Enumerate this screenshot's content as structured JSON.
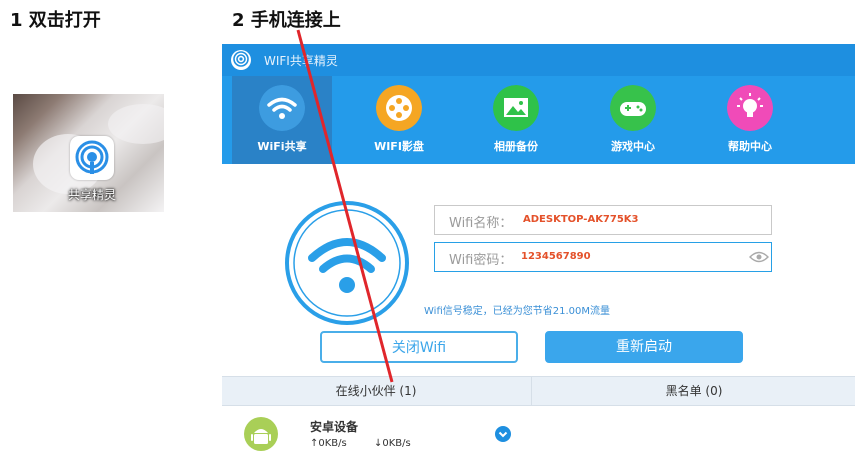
{
  "steps": {
    "step1": "1 双击打开",
    "step2": "2 手机连接上"
  },
  "desktop": {
    "shortcut_label": "共享精灵",
    "shortcut_icon": "wifi-genie-app-icon"
  },
  "app": {
    "title": "WIFI共享精灵",
    "nav": [
      {
        "label": "WiFi共享",
        "icon": "wifi-icon",
        "color": "#2a82c7"
      },
      {
        "label": "WIFI影盘",
        "icon": "film-reel-icon",
        "color": "#f5a623"
      },
      {
        "label": "相册备份",
        "icon": "photo-icon",
        "color": "#2fc249"
      },
      {
        "label": "游戏中心",
        "icon": "gamepad-icon",
        "color": "#37c24b"
      },
      {
        "label": "帮助中心",
        "icon": "lightbulb-icon",
        "color": "#f04bb8"
      }
    ],
    "ssid_label": "Wifi名称：",
    "ssid_value": "ADESKTOP-AK775K3",
    "password_label": "Wifi密码：",
    "password_value": "1234567890",
    "status_text": "Wifi信号稳定，已经为您节省21.00M流量",
    "close_button": "关闭Wifi",
    "restart_button": "重新启动",
    "tab_online": "在线小伙伴 (1)",
    "tab_blacklist": "黑名单 (0)",
    "devices": [
      {
        "name": "安卓设备",
        "upload": "↑0KB/s",
        "download": "↓0KB/s",
        "icon": "android-icon"
      }
    ]
  },
  "colors": {
    "title_bar": "#1e8fe0",
    "nav_bg": "#249bea",
    "accent": "#3aa6ec",
    "value_text": "#e4512a",
    "annotation_line": "#e0262b"
  }
}
